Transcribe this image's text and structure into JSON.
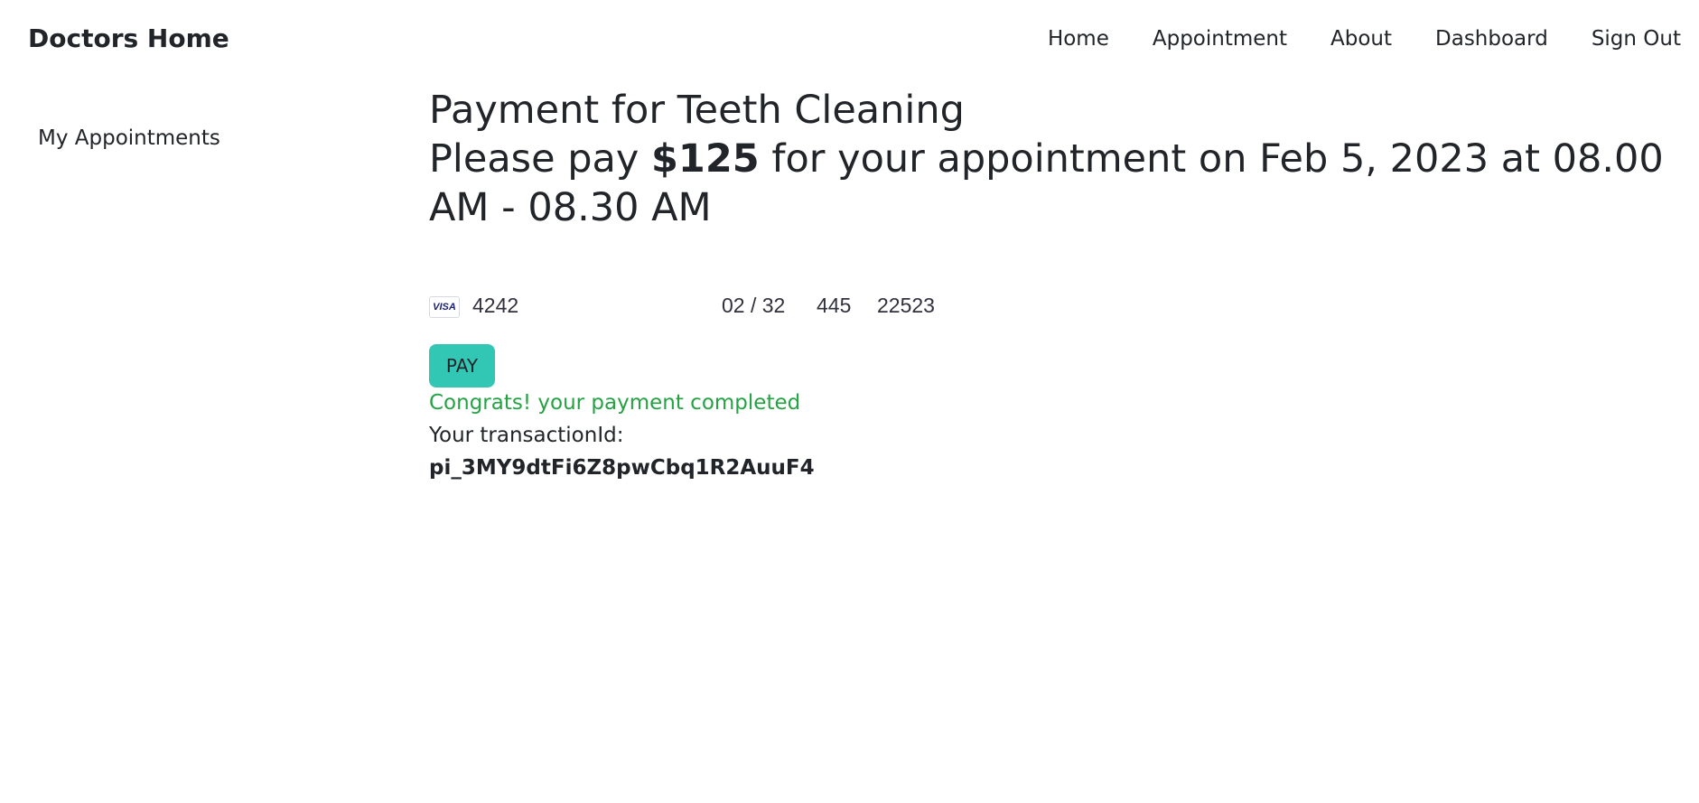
{
  "navbar": {
    "brand": "Doctors Home",
    "links": [
      {
        "label": "Home"
      },
      {
        "label": "Appointment"
      },
      {
        "label": "About"
      },
      {
        "label": "Dashboard"
      },
      {
        "label": "Sign Out"
      }
    ]
  },
  "sidebar": {
    "items": [
      {
        "label": "My Appointments"
      }
    ]
  },
  "main": {
    "title": "Payment for Teeth Cleaning",
    "pay_prefix": "Please pay ",
    "amount": "$125",
    "pay_suffix": " for your appointment on Feb 5, 2023 at 08.00 AM - 08.30 AM",
    "card": {
      "brand_icon": "visa-icon",
      "brand_text": "VISA",
      "number": "4242",
      "expiry": "02 / 32",
      "cvc": "445",
      "zip": "22523"
    },
    "pay_button": "PAY",
    "success_message": "Congrats! your payment completed",
    "transaction_label": "Your transactionId:",
    "transaction_id": "pi_3MY9dtFi6Z8pwCbq1R2AuuF4"
  },
  "colors": {
    "accent": "#32c6b5",
    "success": "#25a244",
    "text": "#212529"
  }
}
